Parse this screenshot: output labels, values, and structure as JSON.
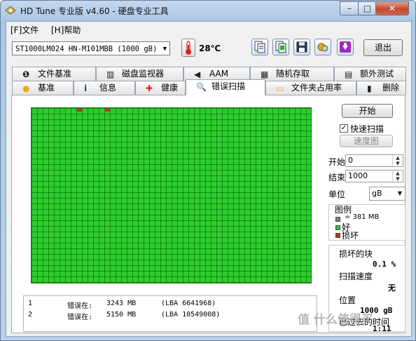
{
  "window": {
    "title": "HD Tune 专业版 v4.60 - 硬盘专业工具",
    "controls": {
      "minimize": "–",
      "maximize": "□",
      "close": "✕"
    }
  },
  "menu": {
    "file": "[F]文件",
    "help": "[H]帮助"
  },
  "toolbar": {
    "drive": "ST1000LM024 HN-M101MBB (1000 gB)",
    "temperature": "28℃",
    "exit_label": "退出",
    "icons": [
      "copy-info-icon",
      "copy-screenshot-icon",
      "save-icon",
      "options-icon",
      "download-icon"
    ]
  },
  "tabs_top": [
    {
      "label": "文件基准",
      "icon": "file-benchmark-icon"
    },
    {
      "label": "磁盘监视器",
      "icon": "disk-monitor-icon"
    },
    {
      "label": "AAM",
      "icon": "speaker-icon"
    },
    {
      "label": "随机存取",
      "icon": "random-access-icon"
    },
    {
      "label": "额外测试",
      "icon": "extra-tests-icon"
    }
  ],
  "tabs_bottom": [
    {
      "label": "基准",
      "icon": "benchmark-icon"
    },
    {
      "label": "信息",
      "icon": "info-icon"
    },
    {
      "label": "健康",
      "icon": "health-icon"
    },
    {
      "label": "错误扫描",
      "icon": "error-scan-icon",
      "active": true
    },
    {
      "label": "文件夹占用率",
      "icon": "folder-usage-icon"
    },
    {
      "label": "删除",
      "icon": "erase-icon"
    }
  ],
  "scan": {
    "blocks_total": 2500,
    "damaged_blocks": [
      {
        "row": 0,
        "col": 8
      },
      {
        "row": 0,
        "col": 13
      }
    ],
    "colors": {
      "good": "#2ecc2e",
      "damaged": "#d12b2b",
      "unknown": "#808080"
    }
  },
  "errors": [
    {
      "index": "1",
      "label": "错误在:",
      "mb": "3243 MB",
      "lba": "(LBA 6641968)"
    },
    {
      "index": "2",
      "label": "错误在:",
      "mb": "5150 MB",
      "lba": "(LBA 10549008)"
    }
  ],
  "controls": {
    "start_button": "开始",
    "quick_scan_label": "快速扫描",
    "quick_scan_checked": true,
    "speed_map_button": "速度图",
    "start_label": "开始",
    "start_value": "0",
    "end_label": "结束",
    "end_value": "1000",
    "unit_label": "单位",
    "unit_value": "gB"
  },
  "legend": {
    "title": "图例",
    "block_size": "= 381 MB",
    "good": "好",
    "damaged": "损坏"
  },
  "stats": {
    "damaged_blocks_label": "损坏的块",
    "damaged_blocks_value": "0.1 %",
    "scan_speed_label": "扫描速度",
    "scan_speed_value": "无",
    "position_label": "位置",
    "position_value": "1000 gB",
    "elapsed_label": "已过去的时间",
    "elapsed_value": "1:11"
  },
  "watermark": "值 什么值得买"
}
